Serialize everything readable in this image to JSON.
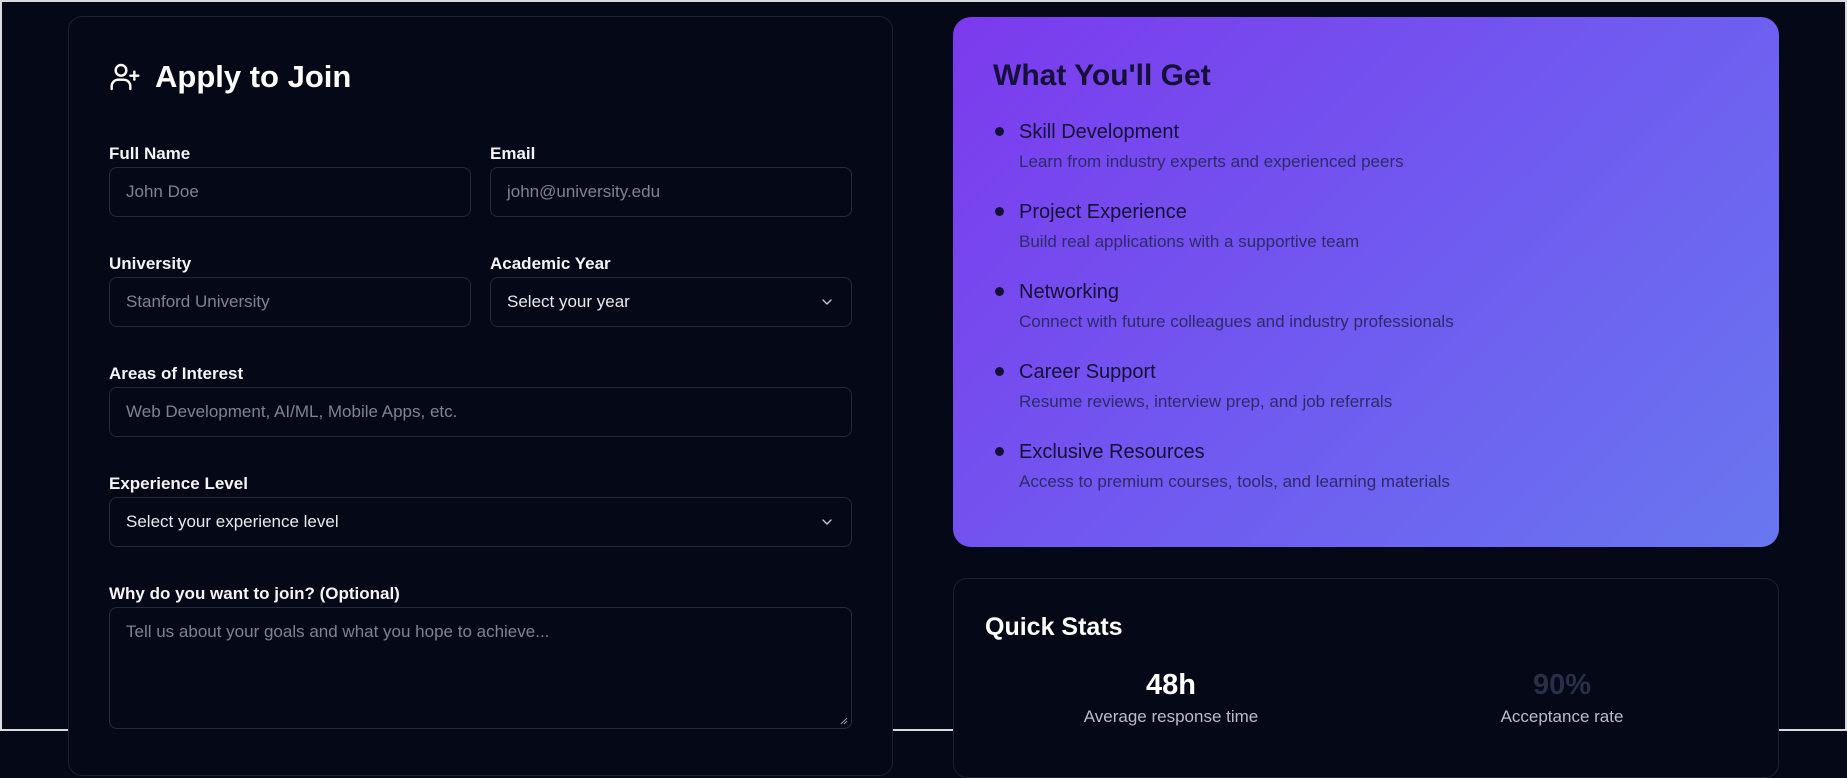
{
  "form": {
    "title": "Apply to Join",
    "title_icon": "user-plus-icon",
    "full_name": {
      "label": "Full Name",
      "placeholder": "John Doe"
    },
    "email": {
      "label": "Email",
      "placeholder": "john@university.edu"
    },
    "university": {
      "label": "University",
      "placeholder": "Stanford University"
    },
    "academic_year": {
      "label": "Academic Year",
      "value": "Select your year"
    },
    "interests": {
      "label": "Areas of Interest",
      "placeholder": "Web Development, AI/ML, Mobile Apps, etc."
    },
    "experience": {
      "label": "Experience Level",
      "value": "Select your experience level"
    },
    "why_join": {
      "label": "Why do you want to join? (Optional)",
      "placeholder": "Tell us about your goals and what you hope to achieve..."
    }
  },
  "benefits": {
    "title": "What You'll Get",
    "items": [
      {
        "title": "Skill Development",
        "desc": "Learn from industry experts and experienced peers"
      },
      {
        "title": "Project Experience",
        "desc": "Build real applications with a supportive team"
      },
      {
        "title": "Networking",
        "desc": "Connect with future colleagues and industry professionals"
      },
      {
        "title": "Career Support",
        "desc": "Resume reviews, interview prep, and job referrals"
      },
      {
        "title": "Exclusive Resources",
        "desc": "Access to premium courses, tools, and learning materials"
      }
    ]
  },
  "stats": {
    "title": "Quick Stats",
    "items": [
      {
        "value": "48h",
        "label": "Average response time",
        "color": "#ffffff"
      },
      {
        "value": "90%",
        "label": "Acceptance rate",
        "color": "#273046"
      }
    ]
  },
  "colors": {
    "background": "#050816",
    "accent_gradient_start": "#7c3aed",
    "accent_gradient_end": "#6877ef"
  }
}
